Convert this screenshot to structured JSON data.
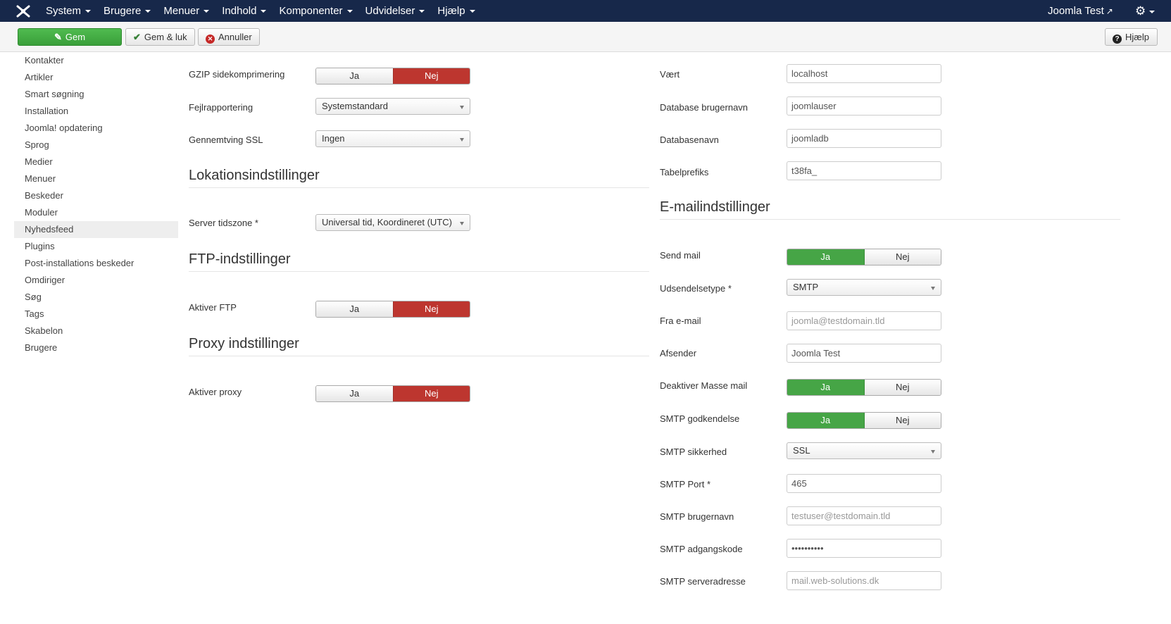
{
  "navbar": {
    "menu": [
      {
        "label": "System"
      },
      {
        "label": "Brugere"
      },
      {
        "label": "Menuer"
      },
      {
        "label": "Indhold"
      },
      {
        "label": "Komponenter"
      },
      {
        "label": "Udvidelser"
      },
      {
        "label": "Hjælp"
      }
    ],
    "site_name": "Joomla Test",
    "colors": {
      "background": "#17284a"
    }
  },
  "toolbar": {
    "save_label": "Gem",
    "save_close_label": "Gem & luk",
    "cancel_label": "Annuller",
    "help_label": "Hjælp"
  },
  "sidebar": {
    "items": [
      {
        "label": "Kontakter"
      },
      {
        "label": "Artikler"
      },
      {
        "label": "Smart søgning"
      },
      {
        "label": "Installation"
      },
      {
        "label": "Joomla! opdatering"
      },
      {
        "label": "Sprog"
      },
      {
        "label": "Medier"
      },
      {
        "label": "Menuer"
      },
      {
        "label": "Beskeder"
      },
      {
        "label": "Moduler"
      },
      {
        "label": "Nyhedsfeed",
        "active": true
      },
      {
        "label": "Plugins"
      },
      {
        "label": "Post-installations beskeder"
      },
      {
        "label": "Omdiriger"
      },
      {
        "label": "Søg"
      },
      {
        "label": "Tags"
      },
      {
        "label": "Skabelon"
      },
      {
        "label": "Brugere"
      }
    ]
  },
  "left": {
    "gzip": {
      "label": "GZIP sidekomprimering",
      "yes": "Ja",
      "no": "Nej",
      "selected": "Nej"
    },
    "error_reporting": {
      "label": "Fejlrapportering",
      "value": "Systemstandard"
    },
    "force_ssl": {
      "label": "Gennemtving SSL",
      "value": "Ingen"
    },
    "location_title": "Lokationsindstillinger",
    "timezone": {
      "label": "Server tidszone *",
      "value": "Universal tid, Koordineret (UTC)"
    },
    "ftp_title": "FTP-indstillinger",
    "ftp": {
      "label": "Aktiver FTP",
      "yes": "Ja",
      "no": "Nej",
      "selected": "Nej"
    },
    "proxy_title": "Proxy indstillinger",
    "proxy": {
      "label": "Aktiver proxy",
      "yes": "Ja",
      "no": "Nej",
      "selected": "Nej"
    }
  },
  "right": {
    "host": {
      "label": "Vært",
      "value": "localhost"
    },
    "db_user": {
      "label": "Database brugernavn",
      "value": "joomlauser"
    },
    "db_name": {
      "label": "Databasenavn",
      "value": "joomladb"
    },
    "prefix": {
      "label": "Tabelprefiks",
      "value": "t38fa_"
    },
    "mail_title": "E-mailindstillinger",
    "send_mail": {
      "label": "Send mail",
      "yes": "Ja",
      "no": "Nej",
      "selected": "Ja"
    },
    "mailer": {
      "label": "Udsendelsetype *",
      "value": "SMTP"
    },
    "from_email": {
      "label": "Fra e-mail",
      "value": "joomla@testdomain.tld"
    },
    "from_name": {
      "label": "Afsender",
      "value": "Joomla Test"
    },
    "mass_mail": {
      "label": "Deaktiver Masse mail",
      "yes": "Ja",
      "no": "Nej",
      "selected": "Ja"
    },
    "smtp_auth": {
      "label": "SMTP godkendelse",
      "yes": "Ja",
      "no": "Nej",
      "selected": "Ja"
    },
    "smtp_secure": {
      "label": "SMTP sikkerhed",
      "value": "SSL"
    },
    "smtp_port": {
      "label": "SMTP Port *",
      "value": "465"
    },
    "smtp_user": {
      "label": "SMTP brugernavn",
      "value": "testuser@testdomain.tld"
    },
    "smtp_pass": {
      "label": "SMTP adgangskode",
      "value": "••••••••••"
    },
    "smtp_host": {
      "label": "SMTP serveradresse",
      "value": "mail.web-solutions.dk"
    }
  },
  "colors": {
    "green": "#46a546",
    "red": "#bd362f"
  }
}
